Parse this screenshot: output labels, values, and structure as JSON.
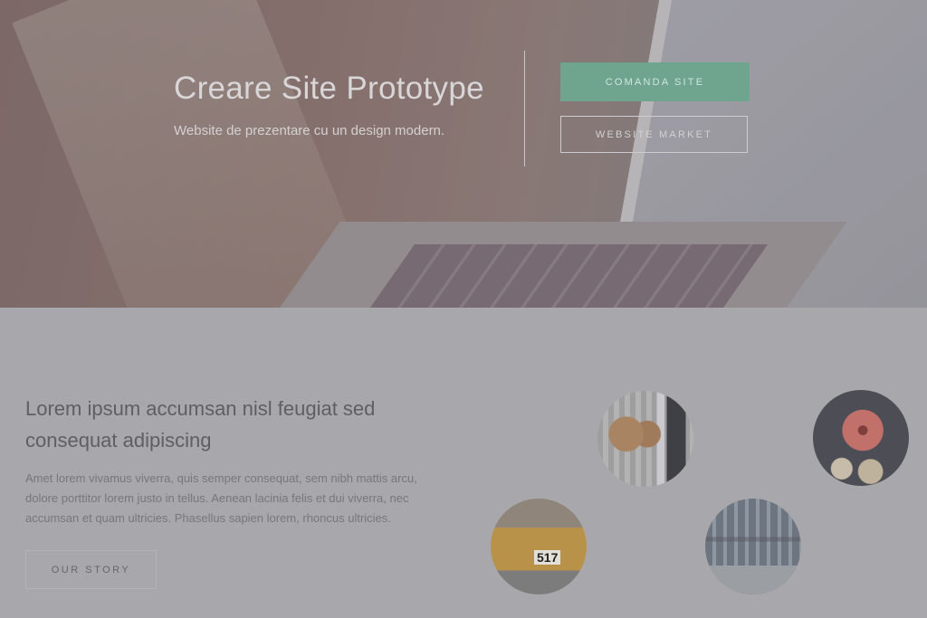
{
  "hero": {
    "title": "Creare Site Prototype",
    "subtitle": "Website de prezentare cu un design modern.",
    "primary_button": "COMANDA SITE",
    "secondary_button": "WEBSITE MARKET",
    "accent_color": "#6fa48f"
  },
  "section": {
    "heading": "Lorem ipsum accumsan nisl feugiat sed consequat adipiscing",
    "body": "Amet lorem vivamus viverra, quis semper consequat, sem nibh mattis arcu, dolore porttitor lorem justo in tellus. Aenean lacinia felis et dui viverra, nec accumsan et quam ultricies. Phasellus sapien lorem, rhoncus ultricies.",
    "button": "OUR STORY"
  },
  "gallery": {
    "car_plate": "517"
  }
}
